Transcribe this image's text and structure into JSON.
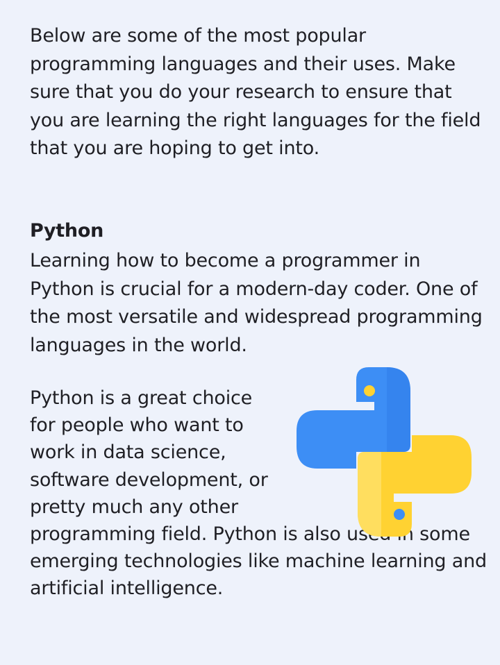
{
  "intro": {
    "text": "Below are some of the most popular programming languages and their uses. Make sure that you do your research to ensure that you are learning the right languages for the field that you are hoping to get into."
  },
  "python": {
    "heading": "Python",
    "description": "Learning how to become a programmer in Python is crucial for a modern-day coder. One of the most versatile and widespread programming languages in the world.",
    "uses_part1": "Python is a great choice for people who want to work in data science, software development, or pretty much any other",
    "uses_part2": "programming field. Python is also used in some emerging technologies like machine learning and artificial intelligence.",
    "logo_icon": "python-logo-icon",
    "colors": {
      "blue": "#3d8ef5",
      "yellow": "#ffd232",
      "background": "#eef2fb"
    }
  }
}
